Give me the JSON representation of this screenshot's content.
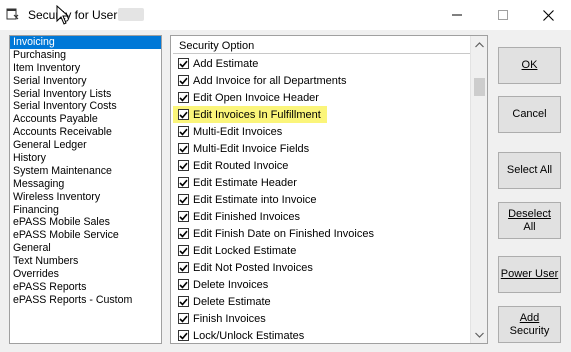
{
  "window": {
    "title": "Security for User:",
    "controls": {
      "minimize": "minimize-icon",
      "maximize": "maximize-icon",
      "close": "close-icon"
    }
  },
  "categories": [
    {
      "label": "Invoicing",
      "selected": true
    },
    {
      "label": "Purchasing"
    },
    {
      "label": "Item Inventory"
    },
    {
      "label": "Serial Inventory"
    },
    {
      "label": "Serial Inventory Lists"
    },
    {
      "label": "Serial Inventory Costs"
    },
    {
      "label": "Accounts Payable"
    },
    {
      "label": "Accounts Receivable"
    },
    {
      "label": "General Ledger"
    },
    {
      "label": "History"
    },
    {
      "label": "System Maintenance"
    },
    {
      "label": "Messaging"
    },
    {
      "label": "Wireless Inventory"
    },
    {
      "label": "Financing"
    },
    {
      "label": "ePASS Mobile Sales"
    },
    {
      "label": "ePASS Mobile Service"
    },
    {
      "label": "General"
    },
    {
      "label": "Text Numbers"
    },
    {
      "label": "Overrides"
    },
    {
      "label": "ePASS Reports"
    },
    {
      "label": "ePASS Reports - Custom"
    }
  ],
  "options": {
    "header": "Security Option",
    "items": [
      {
        "label": "Add Estimate",
        "checked": true
      },
      {
        "label": "Add Invoice for all Departments",
        "checked": true
      },
      {
        "label": "Edit Open Invoice Header",
        "checked": true
      },
      {
        "label": "Edit Invoices In Fulfillment",
        "checked": true,
        "highlighted": true
      },
      {
        "label": "Multi-Edit Invoices",
        "checked": true
      },
      {
        "label": "Multi-Edit Invoice Fields",
        "checked": true
      },
      {
        "label": "Edit Routed Invoice",
        "checked": true
      },
      {
        "label": "Edit Estimate Header",
        "checked": true
      },
      {
        "label": "Edit Estimate into Invoice",
        "checked": true
      },
      {
        "label": "Edit Finished Invoices",
        "checked": true
      },
      {
        "label": "Edit Finish Date on Finished Invoices",
        "checked": true
      },
      {
        "label": "Edit Locked Estimate",
        "checked": true
      },
      {
        "label": "Edit Not Posted Invoices",
        "checked": true
      },
      {
        "label": "Delete Invoices",
        "checked": true
      },
      {
        "label": "Delete Estimate",
        "checked": true
      },
      {
        "label": "Finish Invoices",
        "checked": true
      },
      {
        "label": "Lock/Unlock Estimates",
        "checked": true
      }
    ],
    "highlight_color": "#fbf57a"
  },
  "buttons": {
    "ok": "OK",
    "cancel": "Cancel",
    "select_all": "Select All",
    "deselect_all_line1": "Deselect",
    "deselect_all_line2": "All",
    "power_user": "Power User",
    "add_security_line1": "Add",
    "add_security_line2": "Security"
  },
  "colors": {
    "selection": "#0078d7",
    "button_face": "#e1e1e1"
  }
}
